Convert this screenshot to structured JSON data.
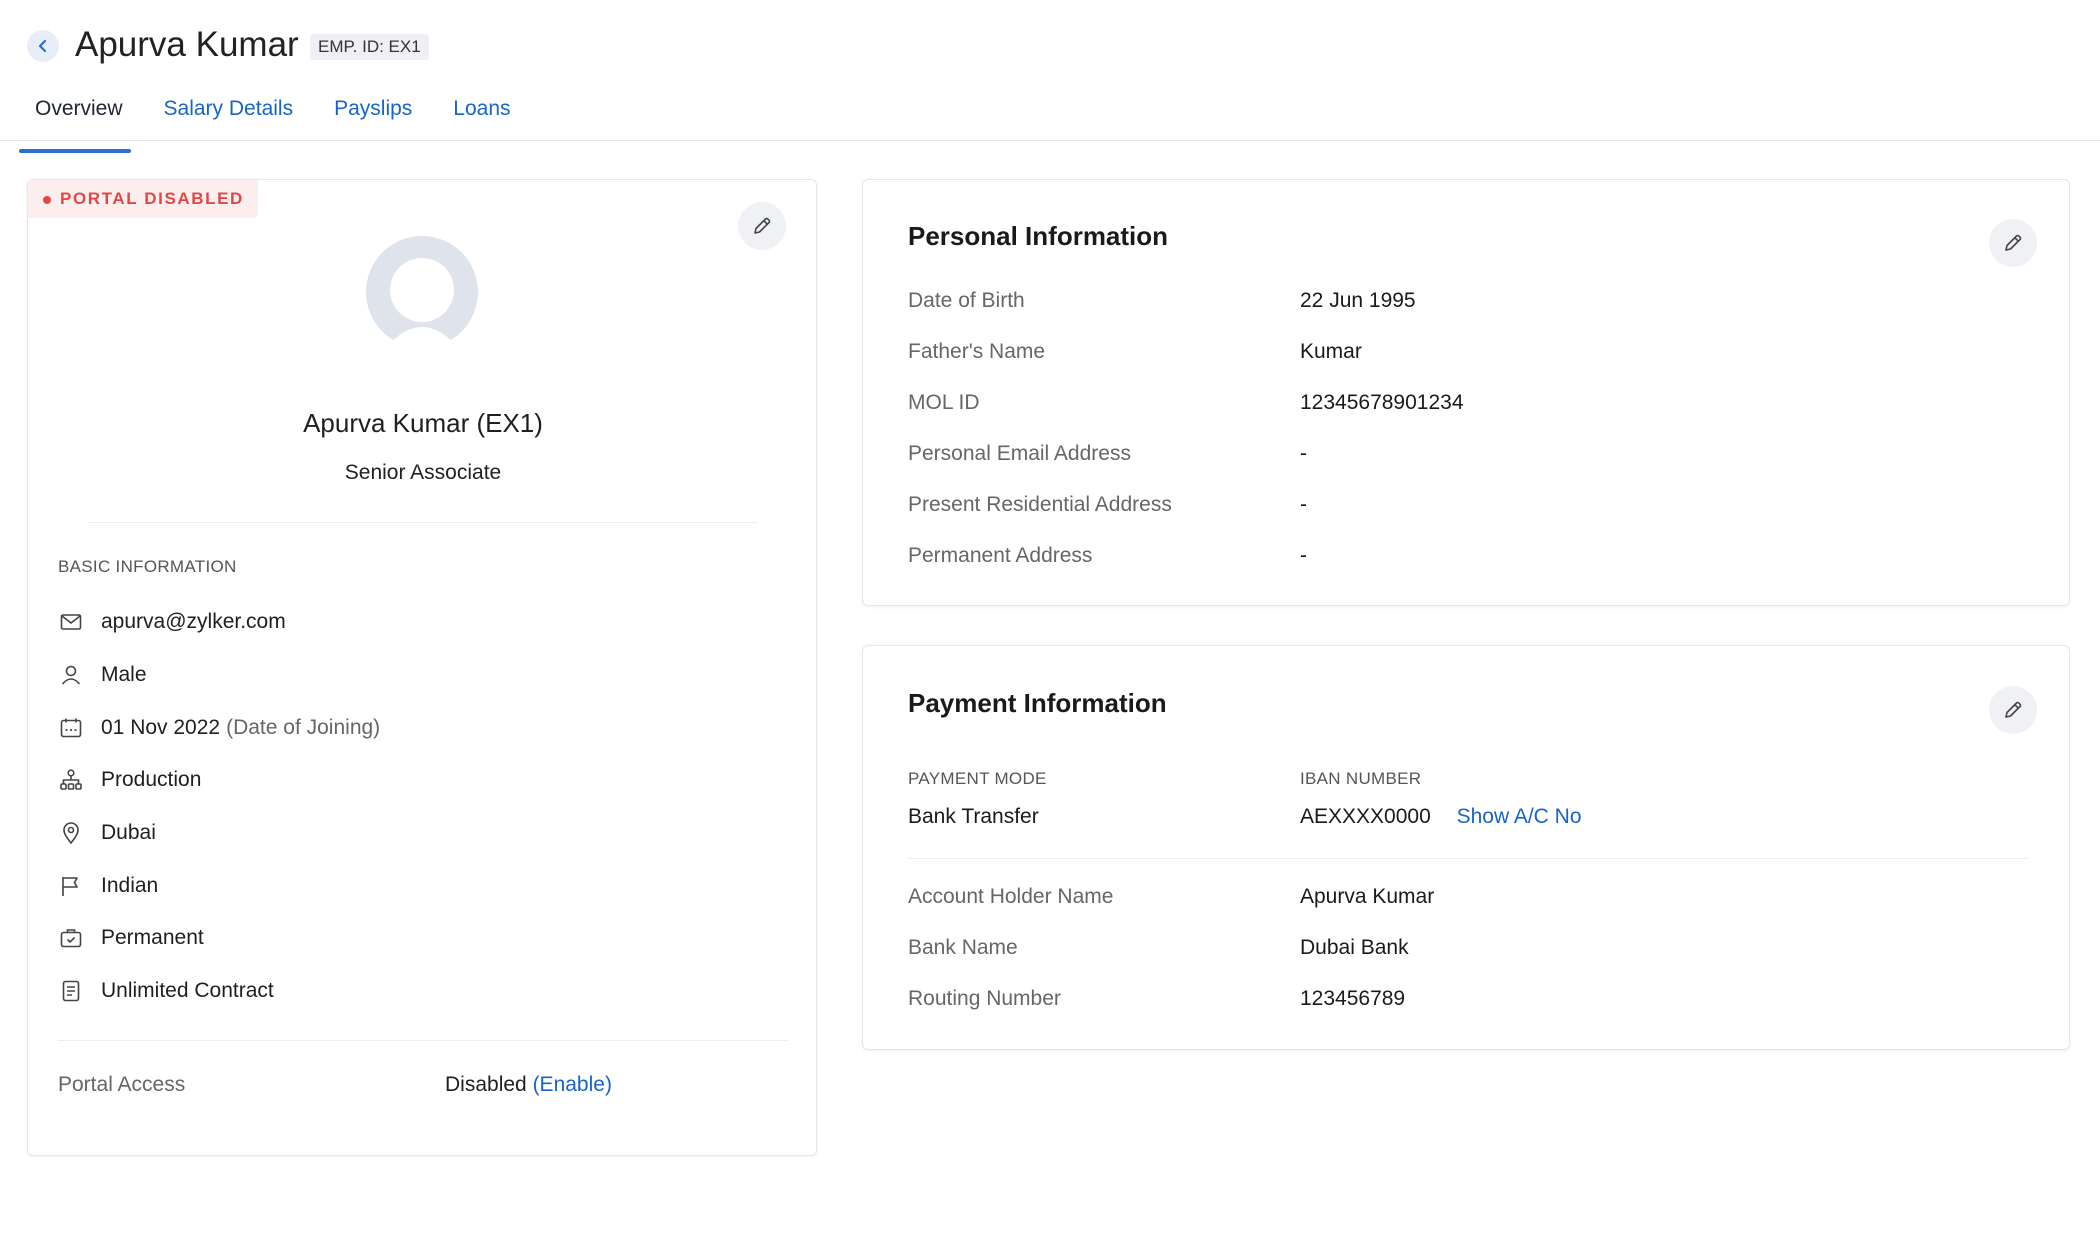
{
  "header": {
    "title": "Apurva Kumar",
    "emp_badge": "EMP. ID: EX1",
    "tabs": [
      {
        "label": "Overview",
        "active": true
      },
      {
        "label": "Salary Details",
        "active": false
      },
      {
        "label": "Payslips",
        "active": false
      },
      {
        "label": "Loans",
        "active": false
      }
    ]
  },
  "profile": {
    "portal_status_badge": "PORTAL DISABLED",
    "name": "Apurva Kumar (EX1)",
    "designation": "Senior Associate",
    "basic_info_heading": "BASIC INFORMATION",
    "basic_info": [
      {
        "icon": "mail-icon",
        "value": "apurva@zylker.com",
        "note": ""
      },
      {
        "icon": "person-icon",
        "value": "Male",
        "note": ""
      },
      {
        "icon": "calendar-icon",
        "value": "01 Nov 2022",
        "note": "(Date of Joining)"
      },
      {
        "icon": "org-chart-icon",
        "value": "Production",
        "note": ""
      },
      {
        "icon": "location-pin-icon",
        "value": "Dubai",
        "note": ""
      },
      {
        "icon": "flag-icon",
        "value": "Indian",
        "note": ""
      },
      {
        "icon": "briefcase-icon",
        "value": "Permanent",
        "note": ""
      },
      {
        "icon": "document-icon",
        "value": "Unlimited Contract",
        "note": ""
      }
    ],
    "portal_access_label": "Portal Access",
    "portal_access_value": "Disabled",
    "portal_access_action": "(Enable)"
  },
  "personal_info": {
    "title": "Personal Information",
    "rows": [
      {
        "label": "Date of Birth",
        "value": "22 Jun 1995"
      },
      {
        "label": "Father's Name",
        "value": "Kumar"
      },
      {
        "label": "MOL ID",
        "value": "12345678901234"
      },
      {
        "label": "Personal Email Address",
        "value": "-"
      },
      {
        "label": "Present Residential Address",
        "value": "-"
      },
      {
        "label": "Permanent Address",
        "value": "-"
      }
    ]
  },
  "payment_info": {
    "title": "Payment Information",
    "payment_mode_label": "PAYMENT MODE",
    "payment_mode_value": "Bank Transfer",
    "iban_label": "IBAN NUMBER",
    "iban_value": "AEXXXX0000",
    "show_account_link": "Show A/C No",
    "rows": [
      {
        "label": "Account Holder Name",
        "value": "Apurva Kumar"
      },
      {
        "label": "Bank Name",
        "value": "Dubai Bank"
      },
      {
        "label": "Routing Number",
        "value": "123456789"
      }
    ]
  },
  "colors": {
    "accent": "#1765c8",
    "badge_red": "#e04848",
    "muted_text": "#666666"
  }
}
